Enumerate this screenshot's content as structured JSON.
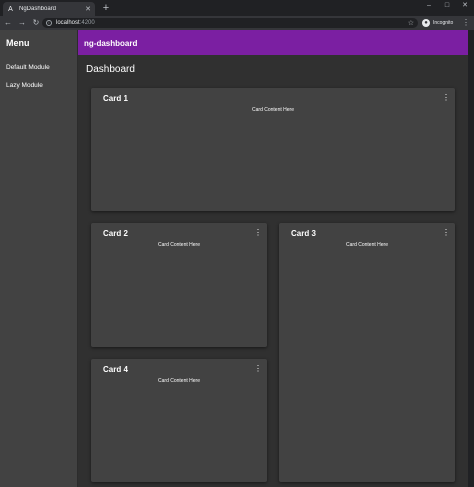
{
  "browser": {
    "tab_title": "NgDashboard",
    "tab_close": "✕",
    "new_tab": "+",
    "url_host": "localhost",
    "url_port": ":4200",
    "profile_label": "Incognito",
    "icons": {
      "favicon": "angular-icon",
      "back": "back-arrow-icon",
      "forward": "forward-arrow-icon",
      "reload": "reload-icon",
      "info": "info-icon",
      "bookmark": "star-icon",
      "profile": "incognito-icon",
      "menu": "kebab-icon"
    }
  },
  "sidebar": {
    "title": "Menu",
    "items": [
      {
        "label": "Default Module"
      },
      {
        "label": "Lazy Module"
      }
    ]
  },
  "header": {
    "title": "ng-dashboard",
    "color": "#7b1fa2"
  },
  "main": {
    "title": "Dashboard",
    "cards": [
      {
        "title": "Card 1",
        "content": "Card Content Here"
      },
      {
        "title": "Card 2",
        "content": "Card Content Here"
      },
      {
        "title": "Card 3",
        "content": "Card Content Here"
      },
      {
        "title": "Card 4",
        "content": "Card Content Here"
      }
    ]
  },
  "colors": {
    "background": "#303030",
    "card": "#424242",
    "sidebar": "#424242"
  }
}
